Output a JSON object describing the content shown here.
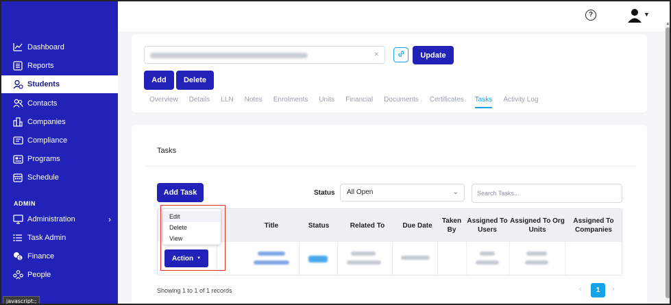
{
  "sidebar": {
    "items": [
      {
        "label": "Dashboard",
        "icon": "chart-line-icon"
      },
      {
        "label": "Reports",
        "icon": "reports-icon"
      },
      {
        "label": "Students",
        "icon": "students-icon",
        "active": true
      },
      {
        "label": "Contacts",
        "icon": "contacts-icon"
      },
      {
        "label": "Companies",
        "icon": "companies-icon"
      },
      {
        "label": "Compliance",
        "icon": "compliance-icon"
      },
      {
        "label": "Programs",
        "icon": "programs-icon"
      },
      {
        "label": "Schedule",
        "icon": "calendar-icon"
      }
    ],
    "admin_label": "ADMIN",
    "admin_items": [
      {
        "label": "Administration",
        "icon": "monitor-icon"
      },
      {
        "label": "Task Admin",
        "icon": "list-icon"
      },
      {
        "label": "Finance",
        "icon": "coins-icon"
      },
      {
        "label": "People",
        "icon": "people-icon"
      }
    ]
  },
  "status_tooltip": "javascript:;",
  "toolbar": {
    "update_label": "Update",
    "add_label": "Add",
    "delete_label": "Delete"
  },
  "tabs": [
    {
      "label": "Overview"
    },
    {
      "label": "Details"
    },
    {
      "label": "LLN"
    },
    {
      "label": "Notes"
    },
    {
      "label": "Enrolments"
    },
    {
      "label": "Units"
    },
    {
      "label": "Financial"
    },
    {
      "label": "Documents"
    },
    {
      "label": "Certificates"
    },
    {
      "label": "Tasks",
      "active": true
    },
    {
      "label": "Activity Log"
    }
  ],
  "tasks": {
    "title": "Tasks",
    "add_task_label": "Add Task",
    "status_label": "Status",
    "status_value": "All Open",
    "search_placeholder": "Search Tasks...",
    "columns": [
      "Title",
      "Status",
      "Related To",
      "Due Date",
      "Taken By",
      "Assigned To Users",
      "Assigned To Org Units",
      "Assigned To Companies"
    ],
    "action_label": "Action",
    "action_menu": [
      "Edit",
      "Delete",
      "View"
    ],
    "records_text": "Showing 1 to 1 of 1 records",
    "current_page": "1"
  },
  "colors": {
    "sidebar": "#2222b8",
    "accent": "#16a3e8",
    "highlight_box": "#e0312b"
  }
}
